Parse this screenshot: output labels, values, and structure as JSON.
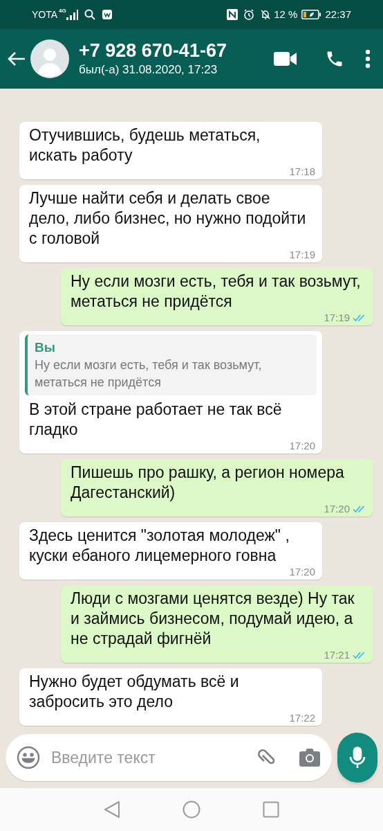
{
  "status_bar": {
    "carrier": "YOTA",
    "network": "4G",
    "battery": "12 %",
    "time": "22:37"
  },
  "header": {
    "title": "+7 928 670-41-67",
    "subtitle": "был(-а) 31.08.2020, 17:23"
  },
  "messages": [
    {
      "kind": "incoming",
      "text": "Отучившись, будешь метаться, искать работу",
      "time": "17:18"
    },
    {
      "kind": "incoming",
      "text": "Лучше найти себя и делать свое дело, либо бизнес, но нужно подойти с головой",
      "time": "17:19"
    },
    {
      "kind": "outgoing",
      "text": "Ну если мозги есть, тебя и так возьмут, метаться не придётся",
      "time": "17:19",
      "read": true
    },
    {
      "kind": "incoming",
      "text": "В этой стране работает не так всё гладко",
      "time": "17:20",
      "quote": {
        "author": "Вы",
        "text": "Ну если мозги есть, тебя и так возьмут, метаться не придётся"
      }
    },
    {
      "kind": "outgoing",
      "text": "Пишешь про рашку, а регион номера Дагестанский)",
      "time": "17:20",
      "read": true
    },
    {
      "kind": "incoming",
      "text": "Здесь ценится \"золотая молодеж\" , куски ебаного лицемерного говна",
      "time": "17:20"
    },
    {
      "kind": "outgoing",
      "text": "Люди с мозгами ценятся везде) Ну так и займись бизнесом, подумай идею, а не страдай фигнёй",
      "time": "17:21",
      "read": true
    },
    {
      "kind": "incoming",
      "text": "Нужно будет обдумать всё и забросить это дело",
      "time": "17:22"
    }
  ],
  "composer": {
    "placeholder": "Введите текст"
  }
}
